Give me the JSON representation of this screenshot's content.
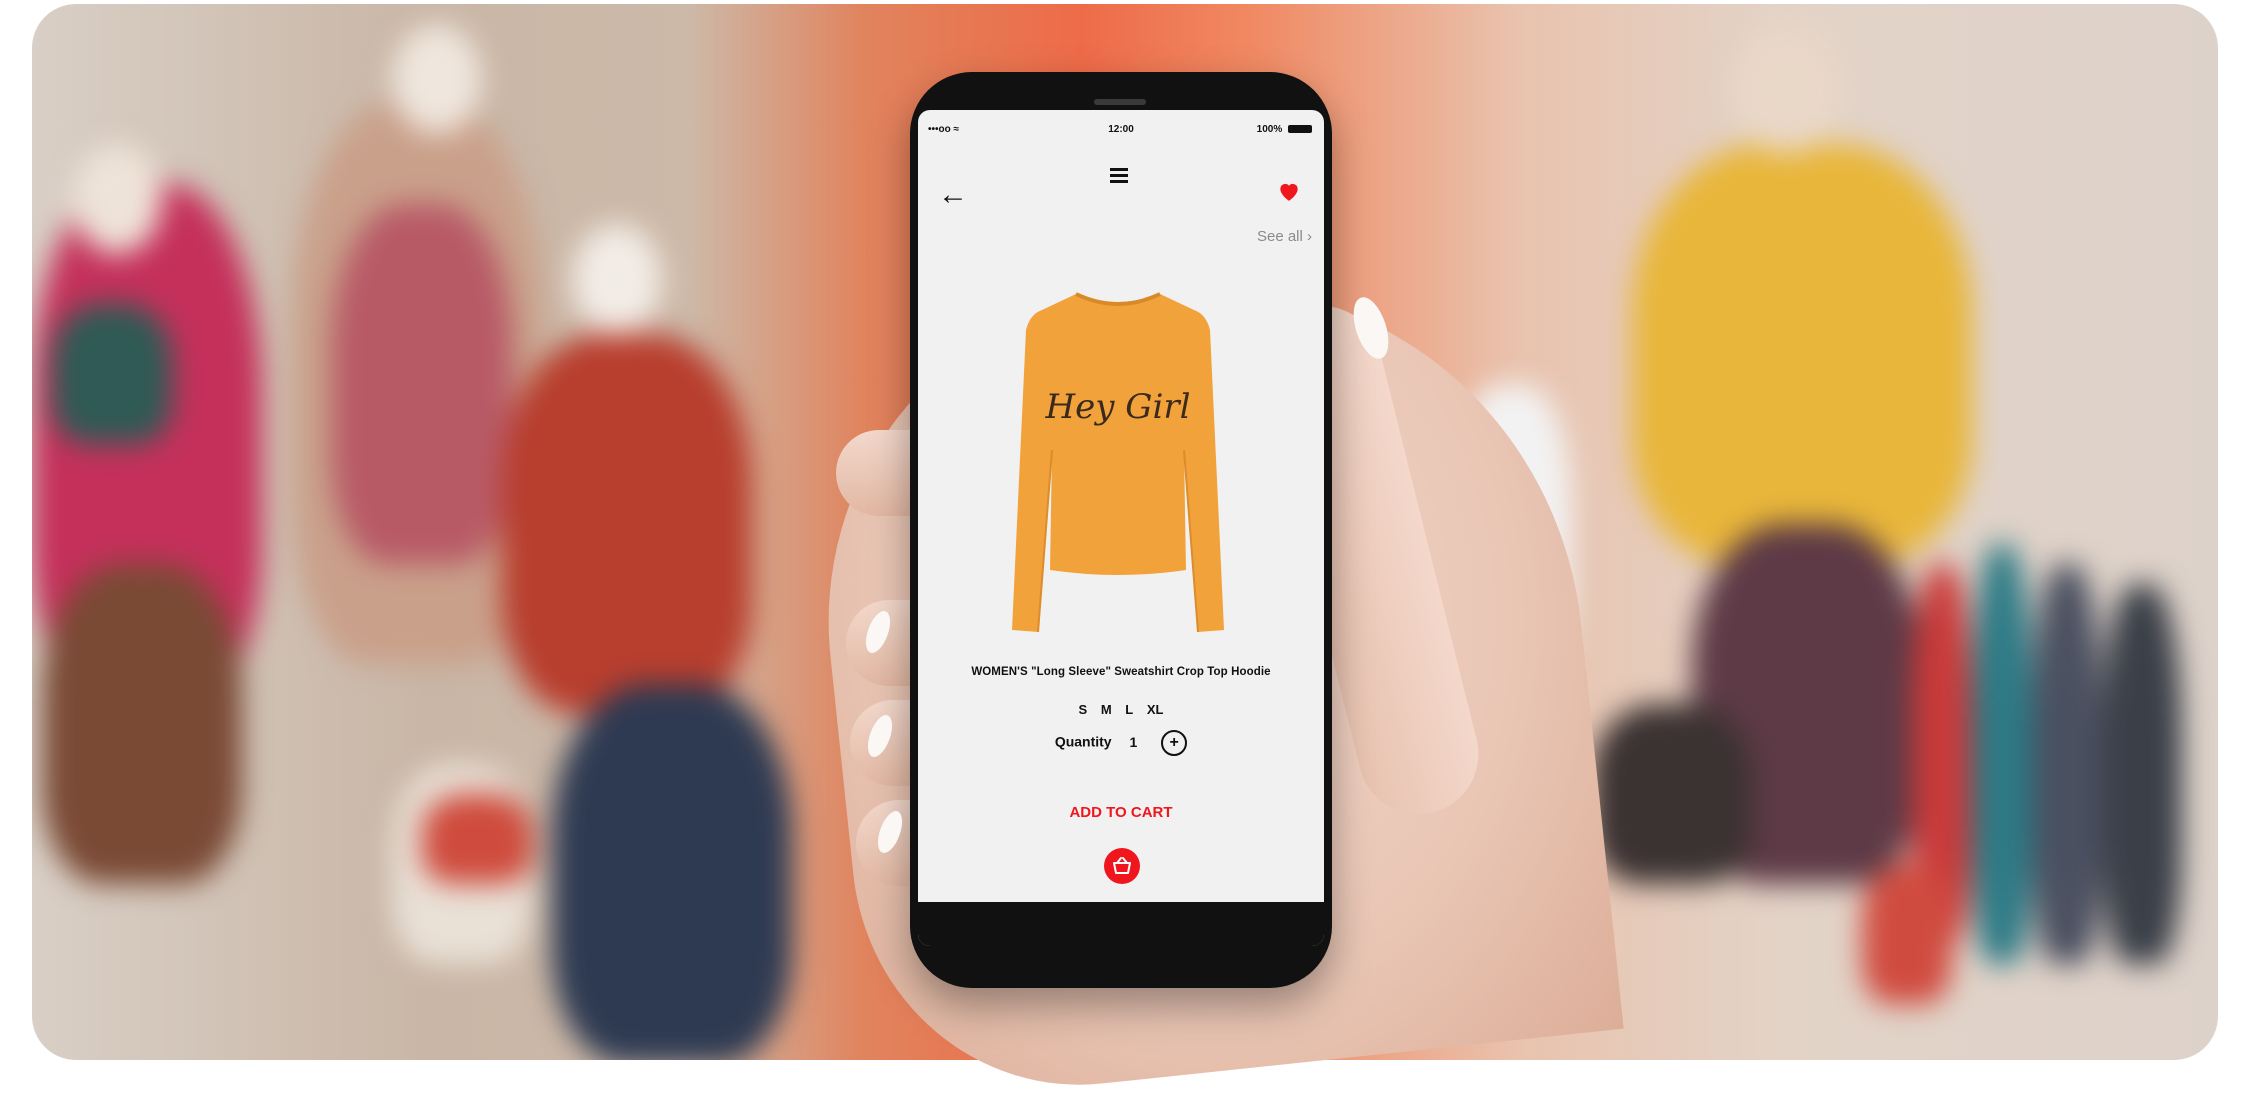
{
  "status_bar": {
    "signal": "•••oo ≈",
    "time": "12:00",
    "battery": "100%"
  },
  "header": {
    "back_icon": "arrow-left-icon",
    "menu_icon": "hamburger-menu-icon",
    "favorite_icon": "heart-icon",
    "see_all": "See all ›"
  },
  "product": {
    "shirt_print": "Hey Girl",
    "title": "WOMEN'S \"Long Sleeve\" Sweatshirt Crop Top Hoodie",
    "sizes": [
      "S",
      "M",
      "L",
      "XL"
    ],
    "quantity_label": "Quantity",
    "quantity_value": "1",
    "plus": "+"
  },
  "actions": {
    "add_to_cart": "ADD TO CART",
    "cart_icon": "shopping-basket-icon"
  },
  "colors": {
    "accent": "#f0161e",
    "shirt": "#f2a23a",
    "screen_bg": "#f1f1f1"
  }
}
